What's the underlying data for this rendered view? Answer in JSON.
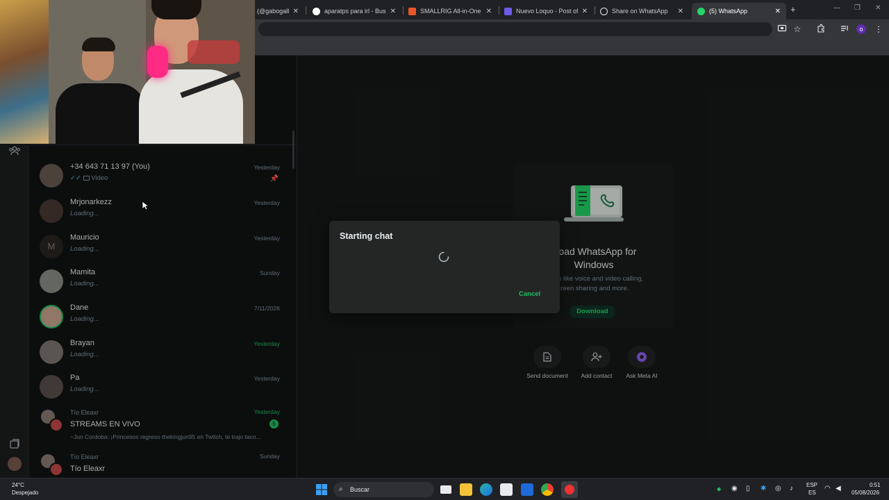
{
  "browser": {
    "tabs": [
      {
        "title": "(@gabogalb",
        "color": "#1d1d1d"
      },
      {
        "title": "aparatps para irl - Buscar",
        "color": "#4285f4"
      },
      {
        "title": "SMALLRIG All-in-One Mo",
        "color": "#e8562a"
      },
      {
        "title": "Nuevo Loquo - Post of K",
        "color": "#6c5ce7"
      },
      {
        "title": "Share on WhatsApp",
        "color": "#e8eaed"
      },
      {
        "title": "(5) WhatsApp",
        "color": "#25d366"
      }
    ],
    "new_tab": "+",
    "close": "✕",
    "profile_initial": "o"
  },
  "chats": [
    {
      "name": "+34 643 71 13 97 (You)",
      "preview": "Video",
      "time": "Yesterday",
      "time_green": false,
      "pinned": true,
      "avatar_color": "#6b5a52"
    },
    {
      "name": "Mrjonarkezz",
      "preview": "Loading...",
      "time": "Yesterday",
      "time_green": false,
      "avatar_color": "#4a3a35"
    },
    {
      "name": "Mauricio",
      "preview": "Loading...",
      "time": "Yesterday",
      "time_green": false,
      "avatar_letter": "M",
      "avatar_color": "#2a2520"
    },
    {
      "name": "Mamita",
      "preview": "Loading...",
      "time": "Sunday",
      "time_green": false,
      "avatar_color": "#8a8f84"
    },
    {
      "name": "Dane",
      "preview": "Loading...",
      "time": "7/11/2026",
      "time_green": false,
      "avatar_color": "#c9a68c"
    },
    {
      "name": "Brayan",
      "preview": "Loading...",
      "time": "Yesterday",
      "time_green": true,
      "avatar_color": "#7d7670"
    },
    {
      "name": "Pa",
      "preview": "Loading...",
      "time": "Yesterday",
      "time_green": false,
      "avatar_color": "#5a4f4a"
    }
  ],
  "group_chat": {
    "sender": "Tío Eleaxr",
    "name": "STREAMS EN VIVO",
    "preview": "~Jun Cordoba: ¡Princesos regreso thekingjun95 en Twitch, te trajo taco...",
    "time": "Yesterday",
    "unread": "5"
  },
  "group_chat2": {
    "sender": "Tío Eleaxr",
    "name": "Tío Eleaxr",
    "time": "Sunday"
  },
  "promo": {
    "title": "nload WhatsApp for Windows",
    "desc_line1": "atures like voice and video calling,",
    "desc_line2": "creen sharing and more.",
    "download_label": "Download"
  },
  "actions": [
    {
      "label": "Send document",
      "icon": "document-icon"
    },
    {
      "label": "Add contact",
      "icon": "add-contact-icon"
    },
    {
      "label": "Ask Meta AI",
      "icon": "meta-ai-icon"
    }
  ],
  "dialog": {
    "title": "Starting chat",
    "cancel_label": "Cancel"
  },
  "taskbar": {
    "weather_temp": "24°C",
    "weather_desc": "Despejado",
    "search_placeholder": "Buscar",
    "lang1": "ESP",
    "lang2": "ES",
    "time": "0:51",
    "date": "05/08/2026"
  },
  "colors": {
    "accent_green": "#21c063",
    "download_bg": "#103529"
  }
}
